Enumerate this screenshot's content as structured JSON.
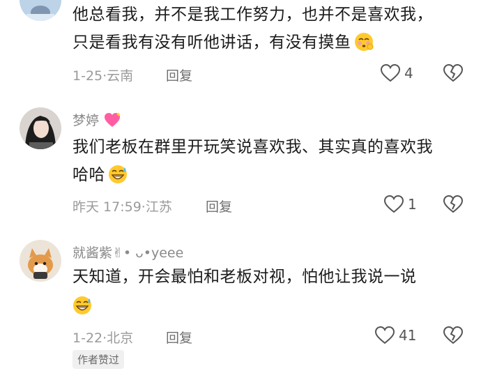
{
  "comments": [
    {
      "lines": [
        "他总看我，并不是我工作努力，也并不是喜欢我，",
        "只是看我有没有听他讲话，有没有摸鱼"
      ],
      "time_location": "1-25·云南",
      "reply_label": "回复",
      "like_count": "4"
    },
    {
      "username": "梦婷",
      "lines": [
        "我们老板在群里开玩笑说喜欢我、其实真的喜欢我",
        "哈哈"
      ],
      "time_location": "昨天 17:59·江苏",
      "reply_label": "回复",
      "like_count": "1"
    },
    {
      "username": "就酱紫✌︎• ᴗ•yeee",
      "lines": [
        "天知道，开会最怕和老板对视，怕他让我说一说",
        ""
      ],
      "time_location": "1-22·北京",
      "reply_label": "回复",
      "like_count": "41",
      "badge": "作者赞过"
    }
  ],
  "icons": {
    "like": "heart-outline-icon",
    "dislike": "broken-heart-icon",
    "emoji_shy": "shy-face-emoji",
    "emoji_grin_sweat": "grinning-sweat-emoji"
  }
}
